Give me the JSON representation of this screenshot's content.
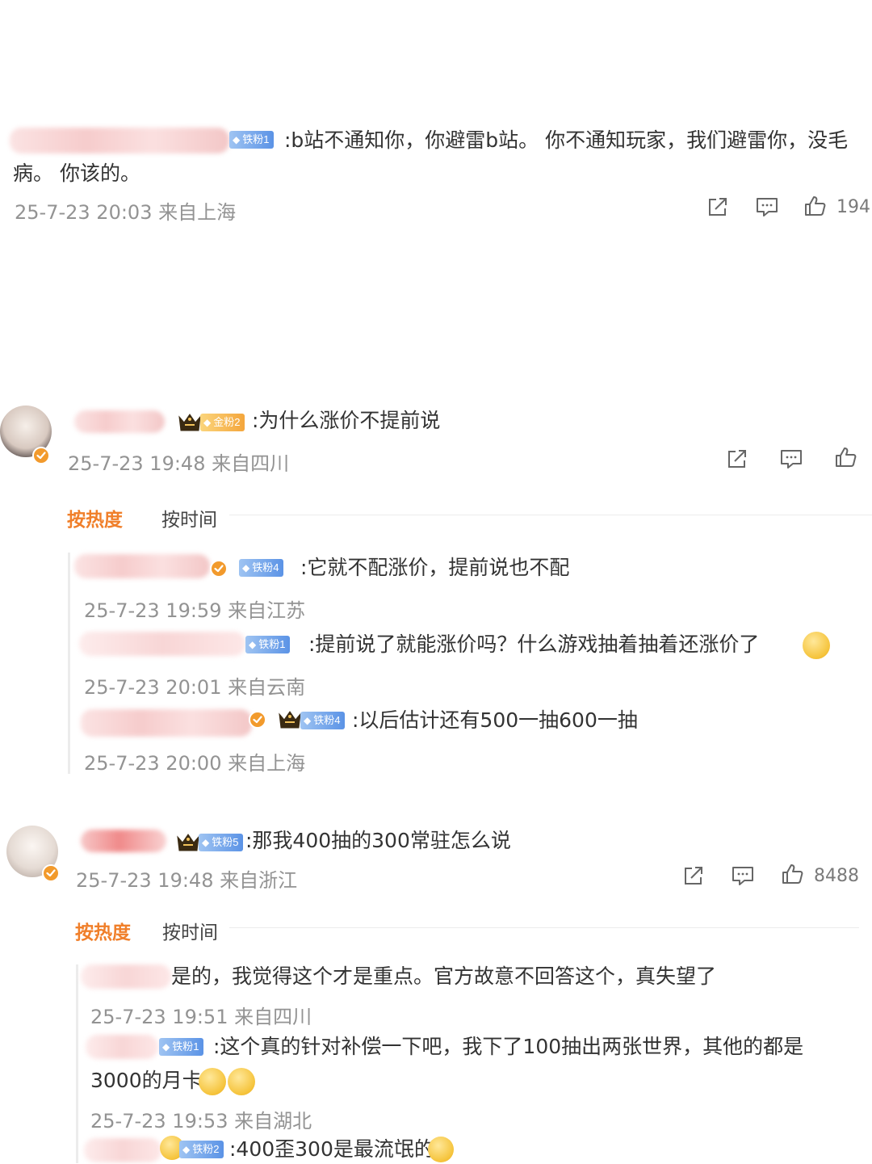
{
  "comment1": {
    "badge": "铁粉1",
    "text_line1": ":b站不通知你，你避雷b站。 你不通知玩家，我们避雷你，没毛",
    "text_line2": "病。 你该的。",
    "meta": "25-7-23 20:03 来自上海",
    "likes": "194"
  },
  "comment2": {
    "badge": "金粉2",
    "text": ":为什么涨价不提前说",
    "meta": "25-7-23 19:48 来自四川",
    "tabs": {
      "hot": "按热度",
      "time": "按时间"
    },
    "replies": [
      {
        "badge": "铁粉4",
        "text": ":它就不配涨价，提前说也不配",
        "meta": "25-7-23 19:59 来自江苏"
      },
      {
        "badge": "铁粉1",
        "text": ":提前说了就能涨价吗？什么游戏抽着抽着还涨价了",
        "meta": "25-7-23 20:01 来自云南"
      },
      {
        "badge": "铁粉4",
        "text": ":以后估计还有500一抽600一抽",
        "meta": "25-7-23 20:00 来自上海"
      }
    ]
  },
  "comment3": {
    "badge": "铁粉5",
    "text": ":那我400抽的300常驻怎么说",
    "meta": "25-7-23 19:48 来自浙江",
    "likes": "8488",
    "tabs": {
      "hot": "按热度",
      "time": "按时间"
    },
    "replies": [
      {
        "text": "是的，我觉得这个才是重点。官方故意不回答这个，真失望了",
        "meta": "25-7-23 19:51 来自四川"
      },
      {
        "badge": "铁粉1",
        "text_line1": ":这个真的针对补偿一下吧，我下了100抽出两张世界，其他的都是",
        "text_line2": "3000的月卡",
        "meta": "25-7-23 19:53 来自湖北"
      },
      {
        "badge": "铁粉2",
        "text": ":400歪300是最流氓的"
      }
    ]
  },
  "icons": [
    "share-icon",
    "comment-icon",
    "like-icon",
    "crown-icon",
    "verified-icon",
    "diamond-icon",
    "emoji-icon"
  ],
  "colors": {
    "accent": "#f07f2a",
    "meta": "#939393",
    "badge_iron": "#5b93e6",
    "badge_gold": "#f4a63c"
  }
}
